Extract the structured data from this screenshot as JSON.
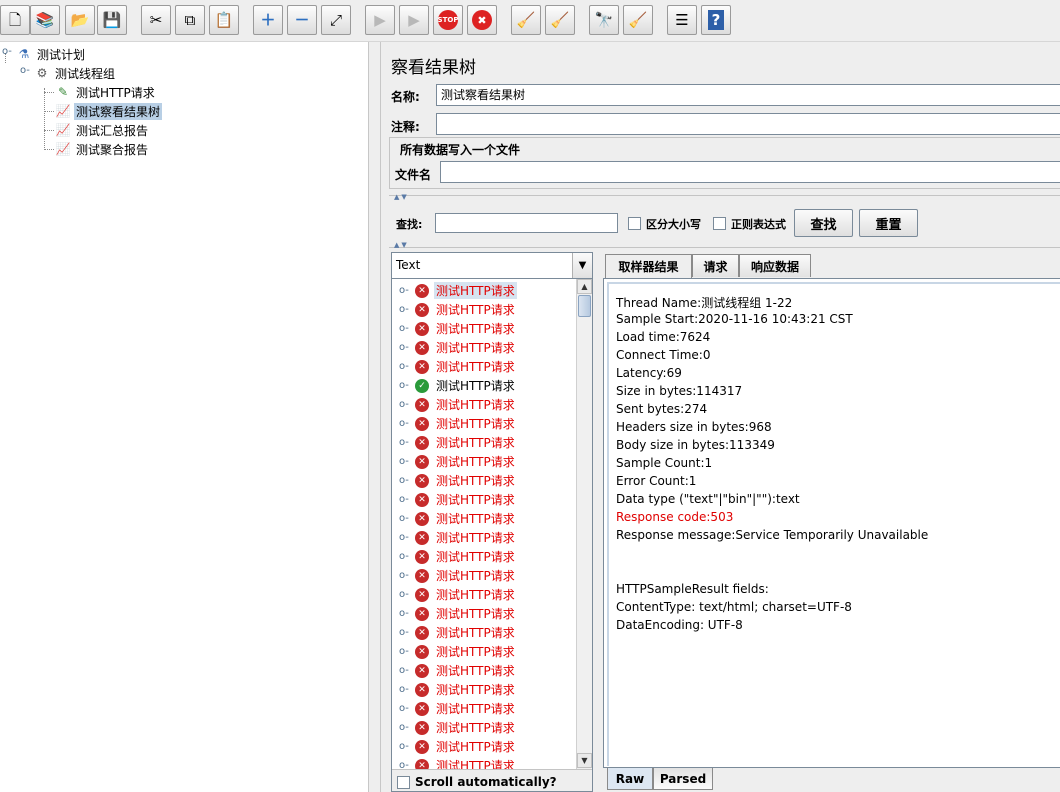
{
  "toolbar": {
    "buttons": [
      {
        "name": "new-button",
        "icon": "new-document-icon",
        "glyph": "🗋"
      },
      {
        "name": "templates-button",
        "icon": "templates-icon",
        "glyph": "📚"
      },
      {
        "name": "open-button",
        "icon": "open-folder-icon",
        "glyph": "📂"
      },
      {
        "name": "save-button",
        "icon": "save-icon",
        "glyph": "💾"
      },
      {
        "name": "cut-button",
        "icon": "scissors-icon",
        "glyph": "✂"
      },
      {
        "name": "copy-button",
        "icon": "copy-icon",
        "glyph": "⧉"
      },
      {
        "name": "paste-button",
        "icon": "clipboard-icon",
        "glyph": "📋"
      },
      {
        "name": "expand-button",
        "icon": "plus-icon",
        "glyph": "＋"
      },
      {
        "name": "collapse-button",
        "icon": "minus-icon",
        "glyph": "－"
      },
      {
        "name": "toggle-button",
        "icon": "toggle-icon",
        "glyph": "⤢"
      },
      {
        "name": "start-button",
        "icon": "play-icon",
        "glyph": "▶"
      },
      {
        "name": "start-no-pause-button",
        "icon": "play-no-timers-icon",
        "glyph": "▶"
      },
      {
        "name": "stop-button",
        "icon": "stop-icon",
        "glyph": "STOP"
      },
      {
        "name": "shutdown-button",
        "icon": "shutdown-icon",
        "glyph": "✖"
      },
      {
        "name": "clear-button",
        "icon": "broom-icon",
        "glyph": "🧹"
      },
      {
        "name": "clear-all-button",
        "icon": "brooms-icon",
        "glyph": "🧹"
      },
      {
        "name": "search-button",
        "icon": "binoculars-icon",
        "glyph": "🔭"
      },
      {
        "name": "reset-search-button",
        "icon": "broom-reset-icon",
        "glyph": "🧹"
      },
      {
        "name": "function-helper-button",
        "icon": "list-icon",
        "glyph": "☰"
      },
      {
        "name": "help-button",
        "icon": "help-icon",
        "glyph": "?"
      }
    ]
  },
  "tree": {
    "nodes": [
      {
        "label": "测试计划",
        "icon": "flask-icon",
        "glyph": "⚗",
        "color": "#3b6fb6"
      },
      {
        "label": "测试线程组",
        "icon": "gear-icon",
        "glyph": "⚙",
        "color": "#5a5a5a"
      },
      {
        "label": "测试HTTP请求",
        "icon": "pipette-icon",
        "glyph": "✎",
        "color": "#3a8a3a"
      },
      {
        "label": "测试察看结果树",
        "icon": "graph-icon",
        "glyph": "📈",
        "color": "#8a4aa6"
      },
      {
        "label": "测试汇总报告",
        "icon": "graph-icon",
        "glyph": "📈",
        "color": "#8a4aa6"
      },
      {
        "label": "测试聚合报告",
        "icon": "graph-icon",
        "glyph": "📈",
        "color": "#8a4aa6"
      }
    ]
  },
  "panel": {
    "title": "察看结果树",
    "name_label": "名称:",
    "name_value": "测试察看结果树",
    "comment_label": "注释:",
    "comment_value": "",
    "file_section_title": "所有数据写入一个文件",
    "filename_label": "文件名",
    "filename_value": ""
  },
  "search": {
    "label": "查找:",
    "value": "",
    "case_sensitive_label": "区分大小写",
    "regex_label": "正则表达式",
    "find_button": "查找",
    "reset_button": "重置"
  },
  "results": {
    "renderer": "Text",
    "rows": [
      {
        "label": "测试HTTP请求",
        "status": "fail"
      },
      {
        "label": "测试HTTP请求",
        "status": "fail"
      },
      {
        "label": "测试HTTP请求",
        "status": "fail"
      },
      {
        "label": "测试HTTP请求",
        "status": "fail"
      },
      {
        "label": "测试HTTP请求",
        "status": "fail"
      },
      {
        "label": "测试HTTP请求",
        "status": "ok"
      },
      {
        "label": "测试HTTP请求",
        "status": "fail"
      },
      {
        "label": "测试HTTP请求",
        "status": "fail"
      },
      {
        "label": "测试HTTP请求",
        "status": "fail"
      },
      {
        "label": "测试HTTP请求",
        "status": "fail"
      },
      {
        "label": "测试HTTP请求",
        "status": "fail"
      },
      {
        "label": "测试HTTP请求",
        "status": "fail"
      },
      {
        "label": "测试HTTP请求",
        "status": "fail"
      },
      {
        "label": "测试HTTP请求",
        "status": "fail"
      },
      {
        "label": "测试HTTP请求",
        "status": "fail"
      },
      {
        "label": "测试HTTP请求",
        "status": "fail"
      },
      {
        "label": "测试HTTP请求",
        "status": "fail"
      },
      {
        "label": "测试HTTP请求",
        "status": "fail"
      },
      {
        "label": "测试HTTP请求",
        "status": "fail"
      },
      {
        "label": "测试HTTP请求",
        "status": "fail"
      },
      {
        "label": "测试HTTP请求",
        "status": "fail"
      },
      {
        "label": "测试HTTP请求",
        "status": "fail"
      },
      {
        "label": "测试HTTP请求",
        "status": "fail"
      },
      {
        "label": "测试HTTP请求",
        "status": "fail"
      },
      {
        "label": "测试HTTP请求",
        "status": "fail"
      },
      {
        "label": "测试HTTP请求",
        "status": "fail"
      }
    ],
    "scroll_auto_label": "Scroll automatically?"
  },
  "detail": {
    "tabs": [
      "取样器结果",
      "请求",
      "响应数据"
    ],
    "lines": [
      {
        "text": "Thread Name:测试线程组 1-22",
        "error": false
      },
      {
        "text": "Sample Start:2020-11-16 10:43:21 CST",
        "error": false
      },
      {
        "text": "Load time:7624",
        "error": false
      },
      {
        "text": "Connect Time:0",
        "error": false
      },
      {
        "text": "Latency:69",
        "error": false
      },
      {
        "text": "Size in bytes:114317",
        "error": false
      },
      {
        "text": "Sent bytes:274",
        "error": false
      },
      {
        "text": "Headers size in bytes:968",
        "error": false
      },
      {
        "text": "Body size in bytes:113349",
        "error": false
      },
      {
        "text": "Sample Count:1",
        "error": false
      },
      {
        "text": "Error Count:1",
        "error": false
      },
      {
        "text": "Data type (\"text\"|\"bin\"|\"\"):text",
        "error": false
      },
      {
        "text": "Response code:503",
        "error": true
      },
      {
        "text": "Response message:Service Temporarily Unavailable",
        "error": false
      },
      {
        "text": "",
        "error": false
      },
      {
        "text": "",
        "error": false
      },
      {
        "text": "HTTPSampleResult fields:",
        "error": false
      },
      {
        "text": "ContentType: text/html; charset=UTF-8",
        "error": false
      },
      {
        "text": "DataEncoding: UTF-8",
        "error": false
      }
    ],
    "bottom_tabs": [
      "Raw",
      "Parsed"
    ]
  }
}
